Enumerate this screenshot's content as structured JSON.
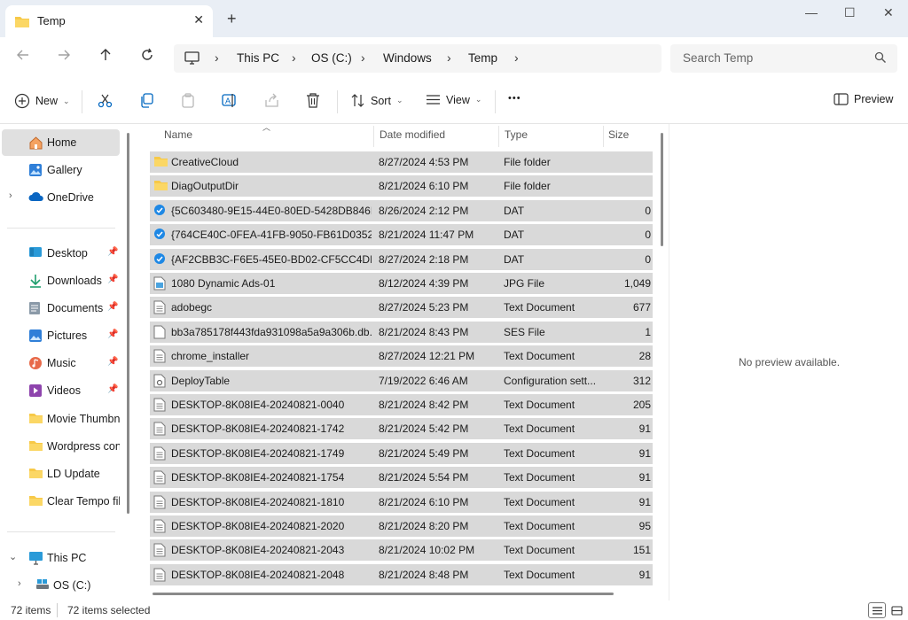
{
  "window": {
    "tab_title": "Temp",
    "new_tab": "+",
    "close_tab": "✕",
    "minimize": "—",
    "maximize": "☐",
    "close": "✕"
  },
  "address": {
    "crumbs": [
      "This PC",
      "OS (C:)",
      "Windows",
      "Temp"
    ],
    "search_placeholder": "Search Temp"
  },
  "toolbar": {
    "new_label": "New",
    "sort_label": "Sort",
    "view_label": "View",
    "more_label": "•••",
    "preview_label": "Preview"
  },
  "sidebar": {
    "home": "Home",
    "gallery": "Gallery",
    "onedrive": "OneDrive",
    "desktop": "Desktop",
    "downloads": "Downloads",
    "documents": "Documents",
    "pictures": "Pictures",
    "music": "Music",
    "videos": "Videos",
    "movie_thumbnails": "Movie Thumbna",
    "wordpress": "Wordpress cont",
    "ld_update": "LD Update",
    "clear_tempo": "Clear Tempo file",
    "this_pc": "This PC",
    "os_c": "OS (C:)"
  },
  "columns": {
    "name": "Name",
    "date": "Date modified",
    "type": "Type",
    "size": "Size"
  },
  "files": [
    {
      "icon": "folder",
      "name": "CreativeCloud",
      "date": "8/27/2024 4:53 PM",
      "type": "File folder",
      "size": ""
    },
    {
      "icon": "folder",
      "name": "DiagOutputDir",
      "date": "8/21/2024 6:10 PM",
      "type": "File folder",
      "size": ""
    },
    {
      "icon": "dat",
      "name": "{5C603480-9E15-44E0-80ED-5428DB846B...",
      "date": "8/26/2024 2:12 PM",
      "type": "DAT",
      "size": "0"
    },
    {
      "icon": "dat",
      "name": "{764CE40C-0FEA-41FB-9050-FB61D0352A...",
      "date": "8/21/2024 11:47 PM",
      "type": "DAT",
      "size": "0"
    },
    {
      "icon": "dat",
      "name": "{AF2CBB3C-F6E5-45E0-BD02-CF5CC4DD...",
      "date": "8/27/2024 2:18 PM",
      "type": "DAT",
      "size": "0"
    },
    {
      "icon": "image",
      "name": "1080 Dynamic Ads-01",
      "date": "8/12/2024 4:39 PM",
      "type": "JPG File",
      "size": "1,049"
    },
    {
      "icon": "text",
      "name": "adobegc",
      "date": "8/27/2024 5:23 PM",
      "type": "Text Document",
      "size": "677"
    },
    {
      "icon": "file",
      "name": "bb3a785178f443fda931098a5a9a306b.db.s...",
      "date": "8/21/2024 8:43 PM",
      "type": "SES File",
      "size": "1"
    },
    {
      "icon": "text",
      "name": "chrome_installer",
      "date": "8/27/2024 12:21 PM",
      "type": "Text Document",
      "size": "28"
    },
    {
      "icon": "config",
      "name": "DeployTable",
      "date": "7/19/2022 6:46 AM",
      "type": "Configuration sett...",
      "size": "312"
    },
    {
      "icon": "text",
      "name": "DESKTOP-8K08IE4-20240821-0040",
      "date": "8/21/2024 8:42 PM",
      "type": "Text Document",
      "size": "205"
    },
    {
      "icon": "text",
      "name": "DESKTOP-8K08IE4-20240821-1742",
      "date": "8/21/2024 5:42 PM",
      "type": "Text Document",
      "size": "91"
    },
    {
      "icon": "text",
      "name": "DESKTOP-8K08IE4-20240821-1749",
      "date": "8/21/2024 5:49 PM",
      "type": "Text Document",
      "size": "91"
    },
    {
      "icon": "text",
      "name": "DESKTOP-8K08IE4-20240821-1754",
      "date": "8/21/2024 5:54 PM",
      "type": "Text Document",
      "size": "91"
    },
    {
      "icon": "text",
      "name": "DESKTOP-8K08IE4-20240821-1810",
      "date": "8/21/2024 6:10 PM",
      "type": "Text Document",
      "size": "91"
    },
    {
      "icon": "text",
      "name": "DESKTOP-8K08IE4-20240821-2020",
      "date": "8/21/2024 8:20 PM",
      "type": "Text Document",
      "size": "95"
    },
    {
      "icon": "text",
      "name": "DESKTOP-8K08IE4-20240821-2043",
      "date": "8/21/2024 10:02 PM",
      "type": "Text Document",
      "size": "151"
    },
    {
      "icon": "text",
      "name": "DESKTOP-8K08IE4-20240821-2048",
      "date": "8/21/2024 8:48 PM",
      "type": "Text Document",
      "size": "91"
    }
  ],
  "preview": {
    "message": "No preview available."
  },
  "status": {
    "count": "72 items",
    "selected": "72 items selected"
  },
  "colors": {
    "accent": "#0067c0",
    "folder": "#f7c948",
    "row_selected": "#d9d9d9"
  }
}
